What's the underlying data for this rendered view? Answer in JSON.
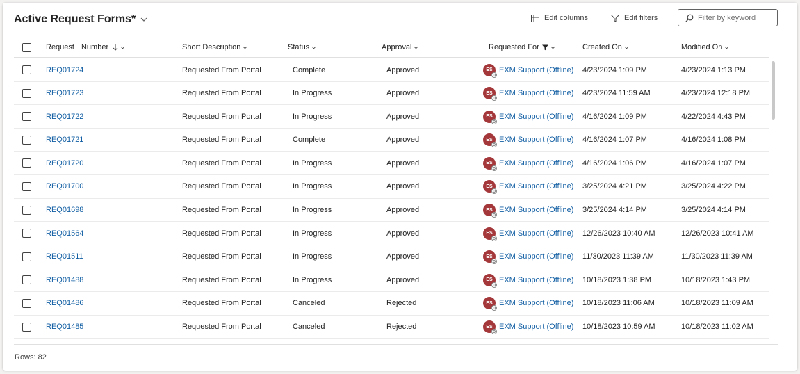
{
  "view": {
    "title": "Active Request Forms*",
    "edit_columns": "Edit columns",
    "edit_filters": "Edit filters",
    "search_placeholder": "Filter by keyword"
  },
  "columns": {
    "request": "Request",
    "number": "Number",
    "short_description": "Short Description",
    "status": "Status",
    "approval": "Approval",
    "requested_for": "Requested For",
    "created_on": "Created On",
    "modified_on": "Modified On"
  },
  "rows": [
    {
      "number": "REQ01724",
      "desc": "Requested From Portal",
      "status": "Complete",
      "approval": "Approved",
      "initials": "ES",
      "requested_for": "EXM Support (Offline)",
      "created": "4/23/2024 1:09 PM",
      "modified": "4/23/2024 1:13 PM"
    },
    {
      "number": "REQ01723",
      "desc": "Requested From Portal",
      "status": "In Progress",
      "approval": "Approved",
      "initials": "ES",
      "requested_for": "EXM Support (Offline)",
      "created": "4/23/2024 11:59 AM",
      "modified": "4/23/2024 12:18 PM"
    },
    {
      "number": "REQ01722",
      "desc": "Requested From Portal",
      "status": "In Progress",
      "approval": "Approved",
      "initials": "ES",
      "requested_for": "EXM Support (Offline)",
      "created": "4/16/2024 1:09 PM",
      "modified": "4/22/2024 4:43 PM"
    },
    {
      "number": "REQ01721",
      "desc": "Requested From Portal",
      "status": "Complete",
      "approval": "Approved",
      "initials": "ES",
      "requested_for": "EXM Support (Offline)",
      "created": "4/16/2024 1:07 PM",
      "modified": "4/16/2024 1:08 PM"
    },
    {
      "number": "REQ01720",
      "desc": "Requested From Portal",
      "status": "In Progress",
      "approval": "Approved",
      "initials": "ES",
      "requested_for": "EXM Support (Offline)",
      "created": "4/16/2024 1:06 PM",
      "modified": "4/16/2024 1:07 PM"
    },
    {
      "number": "REQ01700",
      "desc": "Requested From Portal",
      "status": "In Progress",
      "approval": "Approved",
      "initials": "ES",
      "requested_for": "EXM Support (Offline)",
      "created": "3/25/2024 4:21 PM",
      "modified": "3/25/2024 4:22 PM"
    },
    {
      "number": "REQ01698",
      "desc": "Requested From Portal",
      "status": "In Progress",
      "approval": "Approved",
      "initials": "ES",
      "requested_for": "EXM Support (Offline)",
      "created": "3/25/2024 4:14 PM",
      "modified": "3/25/2024 4:14 PM"
    },
    {
      "number": "REQ01564",
      "desc": "Requested From Portal",
      "status": "In Progress",
      "approval": "Approved",
      "initials": "ES",
      "requested_for": "EXM Support (Offline)",
      "created": "12/26/2023 10:40 AM",
      "modified": "12/26/2023 10:41 AM"
    },
    {
      "number": "REQ01511",
      "desc": "Requested From Portal",
      "status": "In Progress",
      "approval": "Approved",
      "initials": "ES",
      "requested_for": "EXM Support (Offline)",
      "created": "11/30/2023 11:39 AM",
      "modified": "11/30/2023 11:39 AM"
    },
    {
      "number": "REQ01488",
      "desc": "Requested From Portal",
      "status": "In Progress",
      "approval": "Approved",
      "initials": "ES",
      "requested_for": "EXM Support (Offline)",
      "created": "10/18/2023 1:38 PM",
      "modified": "10/18/2023 1:43 PM"
    },
    {
      "number": "REQ01486",
      "desc": "Requested From Portal",
      "status": "Canceled",
      "approval": "Rejected",
      "initials": "ES",
      "requested_for": "EXM Support (Offline)",
      "created": "10/18/2023 11:06 AM",
      "modified": "10/18/2023 11:09 AM"
    },
    {
      "number": "REQ01485",
      "desc": "Requested From Portal",
      "status": "Canceled",
      "approval": "Rejected",
      "initials": "ES",
      "requested_for": "EXM Support (Offline)",
      "created": "10/18/2023 10:59 AM",
      "modified": "10/18/2023 11:02 AM"
    }
  ],
  "footer": {
    "rows_label": "Rows: 82"
  },
  "colors": {
    "link": "#115ea3",
    "avatar": "#a4373a"
  }
}
